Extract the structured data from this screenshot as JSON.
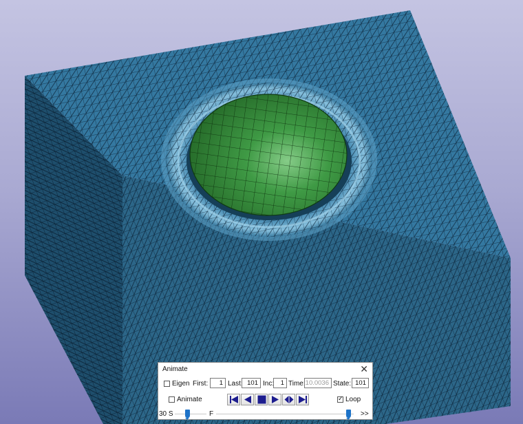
{
  "window": {
    "title": "Animate",
    "close_glyph": "✕"
  },
  "controls": {
    "eigen_label": "Eigen",
    "eigen_checked": false,
    "first_label": "First:",
    "first_value": "1",
    "last_label": "Last:",
    "last_value": "101",
    "inc_label": "Inc:",
    "inc_value": "1",
    "time_label": "Time:",
    "time_value": "10.0036",
    "state_label": "State:",
    "state_value": "101",
    "animate_label": "Animate",
    "animate_checked": false,
    "loop_label": "Loop",
    "loop_checked": true
  },
  "playback": {
    "buttons": [
      "jump-to-first",
      "step-back",
      "stop",
      "play",
      "reverse-play",
      "jump-to-last"
    ]
  },
  "speed": {
    "left_label": "30 S",
    "fast_label": "F",
    "more_label": ">>",
    "speed_position": 0.39,
    "frame_position": 0.98
  },
  "scene": {
    "block_color": "#2f6f93",
    "mesh_color": "#0a1e33",
    "sphere_color": "#2d7a2d",
    "background_top": "#c4c4e2",
    "background_bottom": "#7a7ab6"
  }
}
